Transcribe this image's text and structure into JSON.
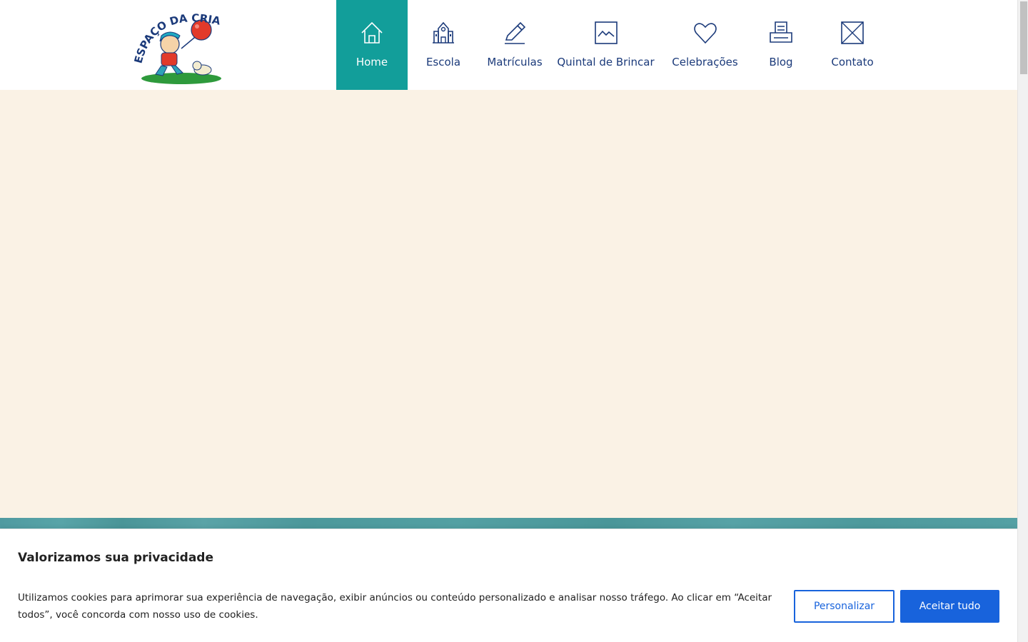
{
  "logo": {
    "arc_text": "ESPAÇO DA CRIANÇA"
  },
  "nav": {
    "items": [
      {
        "label": "Home",
        "icon": "home-icon",
        "active": true
      },
      {
        "label": "Escola",
        "icon": "school-building-icon"
      },
      {
        "label": "Matrículas",
        "icon": "pencil-icon"
      },
      {
        "label": "Quintal de Brincar",
        "icon": "landscape-image-icon"
      },
      {
        "label": "Celebrações",
        "icon": "heart-icon"
      },
      {
        "label": "Blog",
        "icon": "typewriter-icon"
      },
      {
        "label": "Contato",
        "icon": "envelope-icon"
      }
    ]
  },
  "colors": {
    "nav_active_bg": "#129e9a",
    "nav_text": "#1b3a7a",
    "hero_bg": "#faf2e5",
    "band": "#4f9aa0",
    "cookie_button": "#1863dc"
  },
  "cookie": {
    "title": "Valorizamos sua privacidade",
    "text": "Utilizamos cookies para aprimorar sua experiência de navegação, exibir anúncios ou conteúdo personalizado e analisar nosso tráfego. Ao clicar em “Aceitar todos”, você concorda com nosso uso de cookies.",
    "customize_label": "Personalizar",
    "accept_label": "Aceitar tudo"
  }
}
